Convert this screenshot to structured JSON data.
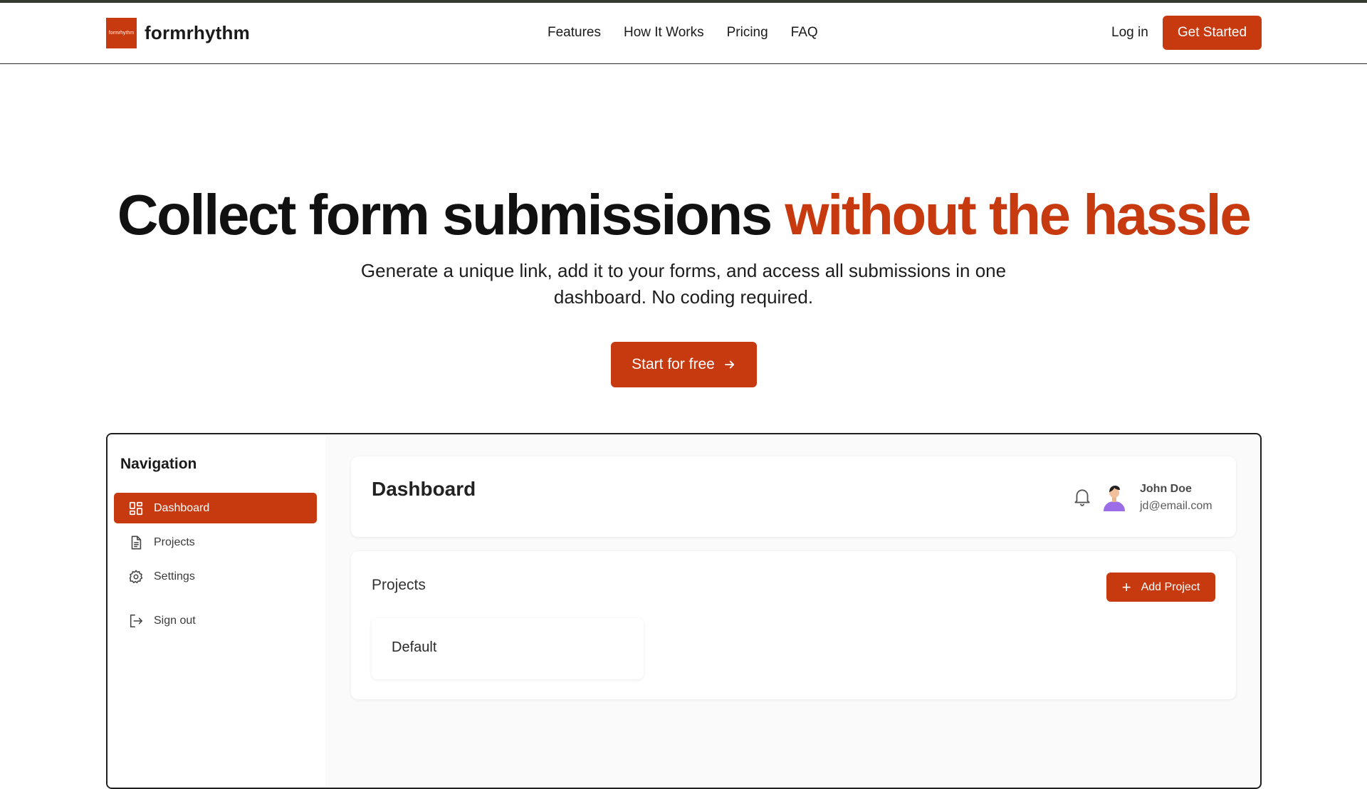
{
  "header": {
    "logo_mark_text": "formrhythm",
    "logo_text": "formrhythm",
    "nav": [
      "Features",
      "How It Works",
      "Pricing",
      "FAQ"
    ],
    "login": "Log in",
    "get_started": "Get Started"
  },
  "hero": {
    "title_main": "Collect form submissions ",
    "title_accent": "without the hassle",
    "subtitle": "Generate a unique link, add it to your forms, and access all submissions in one dashboard. No coding required.",
    "cta": "Start for free",
    "cta_icon": "arrow-right-icon"
  },
  "preview": {
    "sidebar": {
      "title": "Navigation",
      "items": [
        {
          "label": "Dashboard",
          "icon": "dashboard-grid-icon",
          "active": true
        },
        {
          "label": "Projects",
          "icon": "document-icon",
          "active": false
        },
        {
          "label": "Settings",
          "icon": "gear-icon",
          "active": false
        },
        {
          "label": "Sign out",
          "icon": "sign-out-icon",
          "active": false
        }
      ]
    },
    "dashboard": {
      "title": "Dashboard",
      "user_name": "John Doe",
      "user_email": "jd@email.com"
    },
    "projects": {
      "title": "Projects",
      "add_button": "Add Project",
      "items": [
        "Default"
      ]
    }
  },
  "colors": {
    "accent": "#c73a0f",
    "top_strip": "#333a2e"
  }
}
